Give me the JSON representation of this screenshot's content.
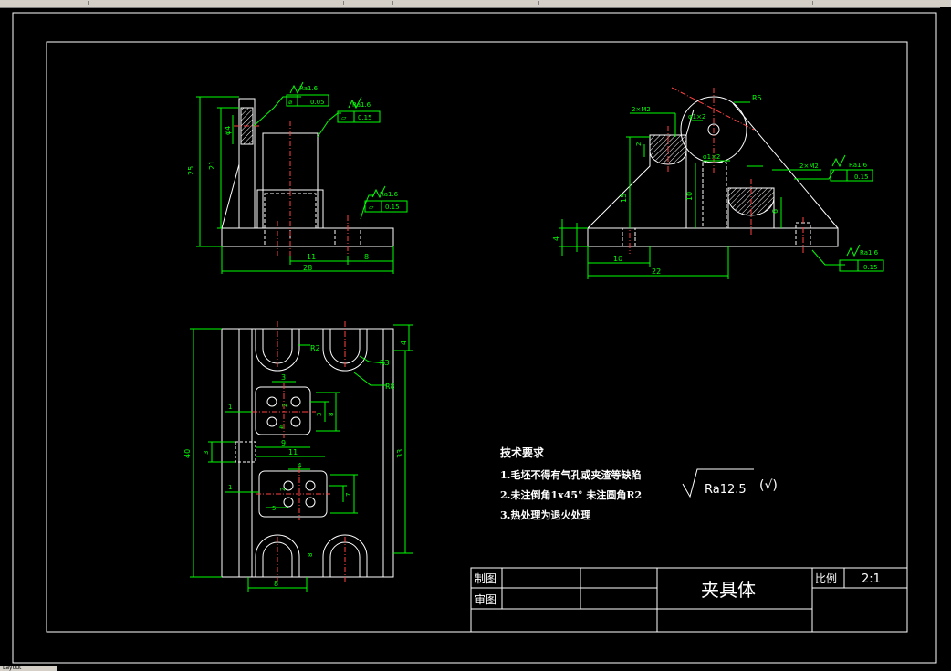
{
  "toolbar": {
    "fragment": "· · ·"
  },
  "model_tab": {
    "label": "Layout"
  },
  "technical_requirements": {
    "heading": "技术要求",
    "items": [
      "1.毛坯不得有气孔或夹渣等缺陷",
      "2.未注倒角1x45° 未注圆角R2",
      "3.热处理为退火处理"
    ]
  },
  "general_roughness": {
    "text": "Ra12.5",
    "suffix": "(√)"
  },
  "title_block": {
    "drawn_by_label": "制图",
    "checked_by_label": "审图",
    "part_name": "夹具体",
    "scale_label": "比例",
    "scale_value": "2:1"
  },
  "front_view": {
    "dims": {
      "height_total": "25",
      "height_inner": "21",
      "hole": "φ4",
      "spacing": "11",
      "end": "8",
      "length": "28"
    },
    "callouts": [
      {
        "roughness": "Ra1.6",
        "tolerance": "0.05",
        "symbol": "⌀"
      },
      {
        "roughness": "Ra1.6",
        "tolerance": "0.15",
        "symbol": "▱"
      },
      {
        "roughness": "Ra1.6",
        "tolerance": "0.15",
        "symbol": "▱"
      }
    ]
  },
  "side_view": {
    "dims": {
      "radius": "R5",
      "thread_left": "2×M2",
      "thread_right": "2×M2",
      "hole_left": "φ1×2",
      "hole_right": "φ1×2",
      "h_left": "15",
      "h_mid": "10",
      "h_right": "6",
      "base": "4",
      "w_left": "10",
      "w_total": "22",
      "dim_small": "2"
    },
    "callouts": [
      {
        "roughness": "Ra1.6",
        "tolerance": "0.15"
      },
      {
        "roughness": "Ra1.6",
        "tolerance": "0.15"
      }
    ]
  },
  "top_view": {
    "dims": {
      "r2": "R2",
      "r3": "R3",
      "r8": "R8",
      "top_right": "4",
      "height_total": "40",
      "height_right": "33",
      "d3_top": "3",
      "d2a": "2",
      "d3_side": "3",
      "d8": "8",
      "d1a": "1",
      "d4_top": "4",
      "d9": "9",
      "d3_left": "3",
      "d11": "11",
      "d4_mid": "4",
      "d2b": "2",
      "d7": "7",
      "d1b": "1",
      "d5": "5",
      "d8_right": "8",
      "d8_bottom": "8"
    }
  }
}
